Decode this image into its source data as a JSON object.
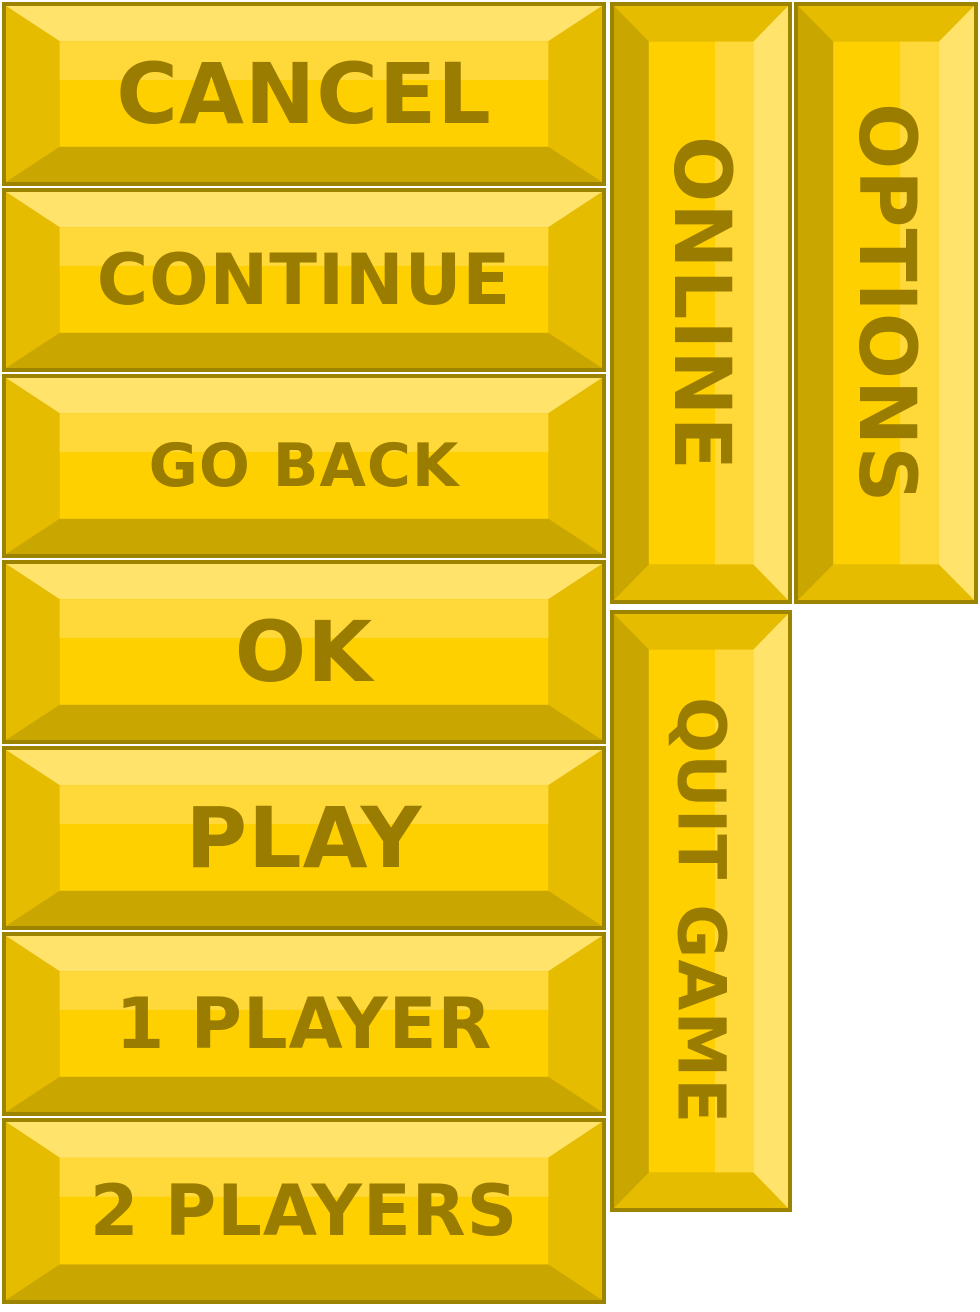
{
  "buttons": {
    "cancel": "CANCEL",
    "continue": "CONTINUE",
    "go_back": "GO BACK",
    "ok": "OK",
    "play": "PLAY",
    "one_player": "1 PLAYER",
    "two_players": "2 PLAYERS",
    "online": "ONLINE",
    "options": "OPTIONS",
    "quit_game": "QUIT GAME"
  },
  "colors": {
    "border": "#9c8300",
    "face": "#ffd000",
    "bevel_light": "#ffe36b",
    "bevel_mid": "#e6bc00",
    "bevel_dark": "#c9a600",
    "text": "#9a7c00"
  }
}
